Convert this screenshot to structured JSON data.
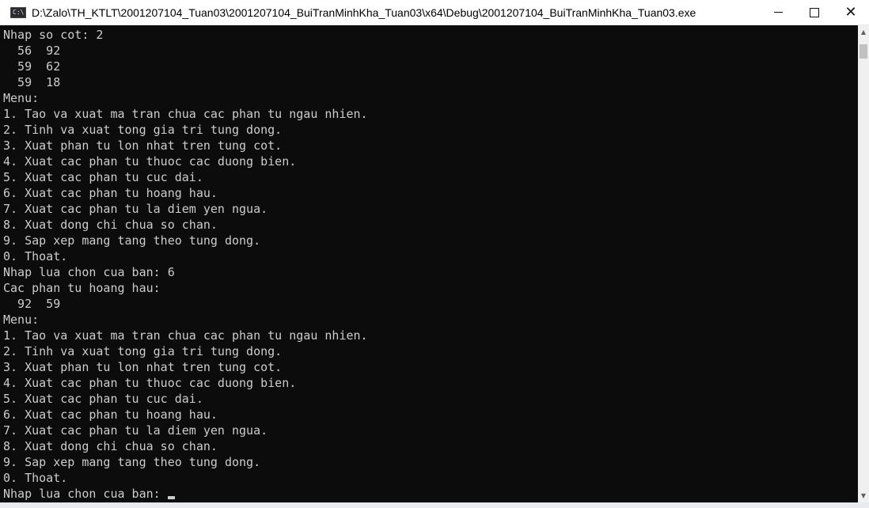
{
  "window": {
    "title": "D:\\Zalo\\TH_KTLT\\2001207104_Tuan03\\2001207104_BuiTranMinhKha_Tuan03\\x64\\Debug\\2001207104_BuiTranMinhKha_Tuan03.exe",
    "icon_label": "C:\\",
    "icon_name": "console-app-icon",
    "controls": {
      "minimize": "minimize-icon",
      "maximize": "maximize-icon",
      "close": "✕"
    }
  },
  "console": {
    "lines": [
      "Nhap so cot: 2",
      "  56  92",
      "  59  62",
      "  59  18",
      "Menu:",
      "1. Tao va xuat ma tran chua cac phan tu ngau nhien.",
      "2. Tinh va xuat tong gia tri tung dong.",
      "3. Xuat phan tu lon nhat tren tung cot.",
      "4. Xuat cac phan tu thuoc cac duong bien.",
      "5. Xuat cac phan tu cuc dai.",
      "6. Xuat cac phan tu hoang hau.",
      "7. Xuat cac phan tu la diem yen ngua.",
      "8. Xuat dong chi chua so chan.",
      "9. Sap xep mang tang theo tung dong.",
      "0. Thoat.",
      "Nhap lua chon cua ban: 6",
      "Cac phan tu hoang hau:",
      "  92  59",
      "Menu:",
      "1. Tao va xuat ma tran chua cac phan tu ngau nhien.",
      "2. Tinh va xuat tong gia tri tung dong.",
      "3. Xuat phan tu lon nhat tren tung cot.",
      "4. Xuat cac phan tu thuoc cac duong bien.",
      "5. Xuat cac phan tu cuc dai.",
      "6. Xuat cac phan tu hoang hau.",
      "7. Xuat cac phan tu la diem yen ngua.",
      "8. Xuat dong chi chua so chan.",
      "9. Sap xep mang tang theo tung dong.",
      "0. Thoat."
    ],
    "prompt": "Nhap lua chon cua ban: "
  },
  "colors": {
    "console_bg": "#0c0c0c",
    "console_text": "#cccccc",
    "titlebar_bg": "#ffffff"
  }
}
